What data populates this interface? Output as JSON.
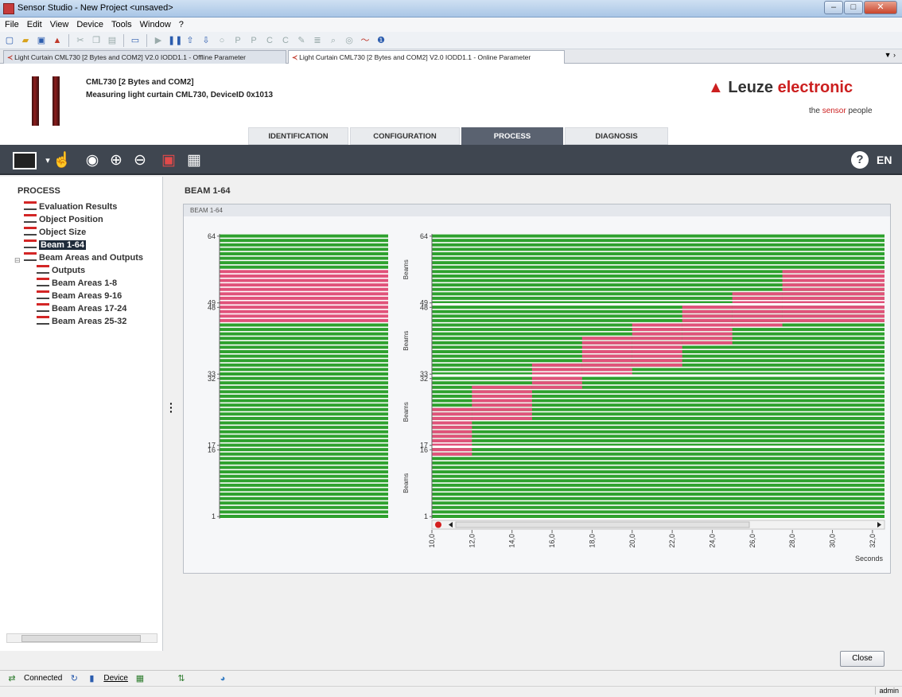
{
  "window": {
    "title": "Sensor Studio - New Project <unsaved>"
  },
  "menu": [
    "File",
    "Edit",
    "View",
    "Device",
    "Tools",
    "Window",
    "?"
  ],
  "doc_tabs": [
    {
      "label": "Light Curtain CML730 [2 Bytes and COM2] V2.0 IODD1.1 - Offline Parameter",
      "active": false
    },
    {
      "label": "Light Curtain CML730 [2 Bytes and COM2] V2.0 IODD1.1 - Online Parameter",
      "active": true
    }
  ],
  "device": {
    "name": "CML730 [2 Bytes and COM2]",
    "description": "Measuring light curtain CML730, DeviceID 0x1013"
  },
  "logo": {
    "brand_part": "Leuze",
    "brand_rest": "electronic",
    "tag_pre": "the",
    "tag_mid": "sensor",
    "tag_post": "people",
    "color": "#cc1f1f"
  },
  "main_tabs": [
    {
      "label": "IDENTIFICATION",
      "active": false
    },
    {
      "label": "CONFIGURATION",
      "active": false
    },
    {
      "label": "PROCESS",
      "active": true
    },
    {
      "label": "DIAGNOSIS",
      "active": false
    }
  ],
  "toolbar_icons": [
    "monitor-icon",
    "arrow-dropdown-icon",
    "hand-icon",
    "record-icon",
    "zoom-in-icon",
    "zoom-out-icon",
    "save-icon",
    "grid-icon"
  ],
  "language": "EN",
  "tree": {
    "title": "PROCESS",
    "items": [
      {
        "label": "Evaluation Results",
        "level": 1,
        "selected": false
      },
      {
        "label": "Object Position",
        "level": 1,
        "selected": false
      },
      {
        "label": "Object Size",
        "level": 1,
        "selected": false
      },
      {
        "label": "Beam 1-64",
        "level": 1,
        "selected": true
      },
      {
        "label": "Beam Areas and Outputs",
        "level": 1,
        "selected": false
      },
      {
        "label": "Outputs",
        "level": 2,
        "selected": false
      },
      {
        "label": "Beam Areas 1-8",
        "level": 2,
        "selected": false
      },
      {
        "label": "Beam Areas 9-16",
        "level": 2,
        "selected": false
      },
      {
        "label": "Beam Areas 17-24",
        "level": 2,
        "selected": false
      },
      {
        "label": "Beam Areas 25-32",
        "level": 2,
        "selected": false
      }
    ]
  },
  "content": {
    "title": "BEAM 1-64",
    "panel_header": "BEAM 1-64"
  },
  "chart_data": [
    {
      "type": "heatmap",
      "title": "",
      "y_ticks": [
        "64",
        "49",
        "48",
        "33",
        "32",
        "17",
        "16",
        "1"
      ],
      "beams": 64,
      "blocked_ranges": [
        [
          45,
          56
        ]
      ],
      "colors": {
        "free": "#2ea12e",
        "blocked": "#e0527a"
      }
    },
    {
      "type": "heatmap",
      "x_label": "Seconds",
      "y_label": "Beams",
      "y_ticks": [
        "64",
        "49",
        "48",
        "33",
        "32",
        "17",
        "16",
        "1"
      ],
      "x_ticks": [
        "10,0",
        "12,0",
        "14,0",
        "16,0",
        "18,0",
        "20,0",
        "22,0",
        "24,0",
        "26,0",
        "28,0",
        "30,0",
        "32,0"
      ],
      "x_range": [
        10,
        32.6
      ],
      "beams": 64,
      "blocked_intervals": [
        {
          "t_start": 10.0,
          "t_end": 12.0,
          "beam_from": 15,
          "beam_to": 25
        },
        {
          "t_start": 12.0,
          "t_end": 15.0,
          "beam_from": 23,
          "beam_to": 30
        },
        {
          "t_start": 15.0,
          "t_end": 17.5,
          "beam_from": 30,
          "beam_to": 35
        },
        {
          "t_start": 17.5,
          "t_end": 20.0,
          "beam_from": 33,
          "beam_to": 41
        },
        {
          "t_start": 20.0,
          "t_end": 22.5,
          "beam_from": 35,
          "beam_to": 44
        },
        {
          "t_start": 22.5,
          "t_end": 25.0,
          "beam_from": 40,
          "beam_to": 48
        },
        {
          "t_start": 25.0,
          "t_end": 27.5,
          "beam_from": 44,
          "beam_to": 51
        },
        {
          "t_start": 27.5,
          "t_end": 32.6,
          "beam_from": 45,
          "beam_to": 56
        }
      ],
      "colors": {
        "free": "#2ea12e",
        "blocked": "#e0527a"
      }
    }
  ],
  "buttons": {
    "close": "Close"
  },
  "status": {
    "connected": "Connected",
    "device": "Device",
    "user": "admin"
  }
}
